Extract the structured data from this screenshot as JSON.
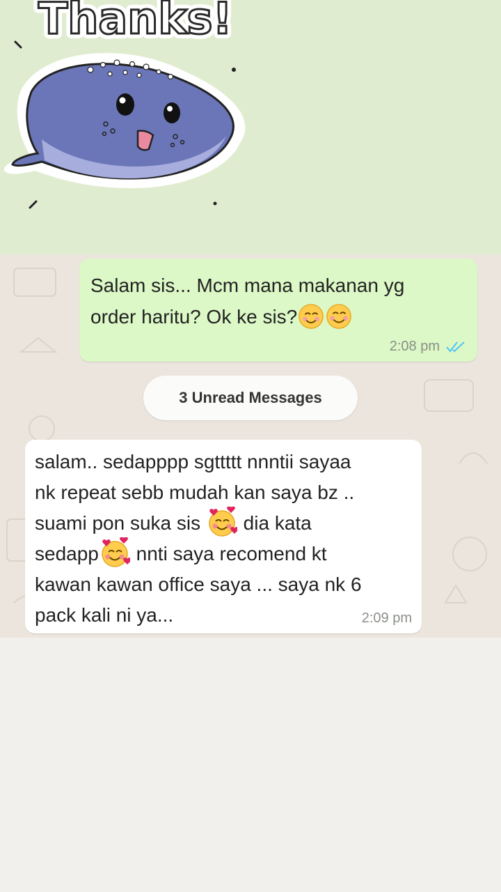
{
  "sticker": {
    "text": "Thanks!",
    "icon": "whale-thanks-sticker"
  },
  "messages": {
    "outgoing": {
      "line1": "Salam sis... Mcm mana makanan yg",
      "line2": "order haritu? Ok ke sis?",
      "emojis": [
        "smiling-face-icon",
        "smiling-face-icon"
      ],
      "time": "2:08 pm",
      "status_icon": "double-check-read-icon",
      "status_color": "#4fc3f7"
    },
    "unread_label": "3 Unread Messages",
    "incoming": {
      "line1": "salam.. sedapppp sgttttt nnntii sayaa",
      "line2": "nk repeat sebb mudah kan saya bz ..",
      "line3a": "suami pon suka sis",
      "line3b": "dia kata",
      "line4a": "sedapp",
      "line4b": "nnti saya recomend kt",
      "line5": "kawan kawan office saya ... saya nk 6",
      "line6": "pack kali ni ya...",
      "emojis": [
        "smiling-face-with-hearts-icon",
        "smiling-face-with-hearts-icon"
      ],
      "time": "2:09 pm"
    }
  },
  "colors": {
    "outgoing_bubble": "#dcf8c6",
    "incoming_bubble": "#ffffff",
    "chat_background": "#ece5dd",
    "sticker_background": "#e0ecd0"
  }
}
